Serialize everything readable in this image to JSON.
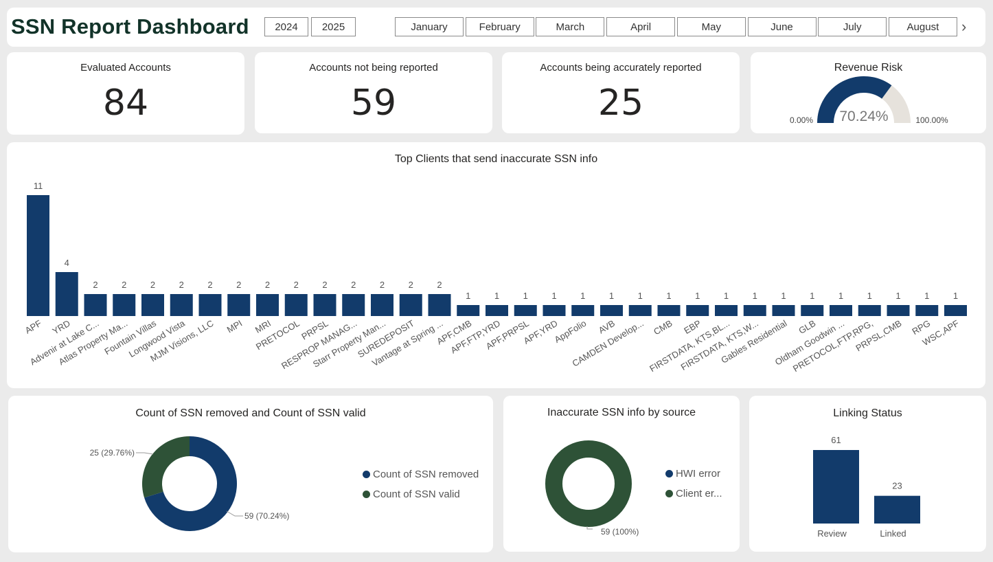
{
  "header": {
    "title": "SSN Report Dashboard",
    "years": [
      "2024",
      "2025"
    ],
    "months": [
      "January",
      "February",
      "March",
      "April",
      "May",
      "June",
      "July",
      "August"
    ]
  },
  "kpis": [
    {
      "label": "Evaluated Accounts",
      "value": "84"
    },
    {
      "label": "Accounts not being reported",
      "value": "59"
    },
    {
      "label": "Accounts being accurately reported",
      "value": "25"
    }
  ],
  "gauge": {
    "title": "Revenue Risk",
    "value_label": "70.24%",
    "min_label": "0.00%",
    "max_label": "100.00%",
    "fraction": 0.7024,
    "fill_color": "#123b6b",
    "track_color": "#e6e2dc"
  },
  "chart_data": [
    {
      "type": "bar",
      "title": "Top Clients that send inaccurate SSN info",
      "categories": [
        "APF",
        "YRD",
        "Advenir at Lake C...",
        "Atlas Property Ma...",
        "Fountain Villas",
        "Longwood Vista",
        "MJM Visions, LLC",
        "MPI",
        "MRI",
        "PRETOCOL",
        "PRPSL",
        "RESPROP MANAG...",
        "Starr Property Man...",
        "SUREDEPOSIT",
        "Vantage at Spring ...",
        "APF,CMB",
        "APF,FTP,YRD",
        "APF,PRPSL",
        "APF,YRD",
        "AppFolio",
        "AVB",
        "CAMDEN Develop...",
        "CMB",
        "EBP",
        "FIRSTDATA, KTS,BL...",
        "FIRSTDATA, KTS,W...",
        "Gables Residential",
        "GLB",
        "Oldham Goodwin ...",
        "PRETOCOL,FTP,RPG,",
        "PRPSL,CMB",
        "RPG",
        "WSC,APF"
      ],
      "values": [
        11,
        4,
        2,
        2,
        2,
        2,
        2,
        2,
        2,
        2,
        2,
        2,
        2,
        2,
        2,
        1,
        1,
        1,
        1,
        1,
        1,
        1,
        1,
        1,
        1,
        1,
        1,
        1,
        1,
        1,
        1,
        1,
        1
      ],
      "color": "#123b6b"
    },
    {
      "type": "pie",
      "title": "Count of SSN removed and Count of SSN valid",
      "labels": [
        "Count of SSN removed",
        "Count of SSN valid"
      ],
      "values": [
        59,
        25
      ],
      "data_labels": [
        "59 (70.24%)",
        "25 (29.76%)"
      ],
      "colors": [
        "#123b6b",
        "#2e5237"
      ]
    },
    {
      "type": "pie",
      "title": "Inaccurate SSN info by source",
      "labels": [
        "HWI error",
        "Client er..."
      ],
      "values": [
        0,
        59
      ],
      "data_labels": [
        "59 (100%)"
      ],
      "colors": [
        "#123b6b",
        "#2e5237"
      ]
    },
    {
      "type": "bar",
      "title": "Linking Status",
      "categories": [
        "Review",
        "Linked"
      ],
      "values": [
        61,
        23
      ],
      "color": "#123b6b"
    }
  ]
}
